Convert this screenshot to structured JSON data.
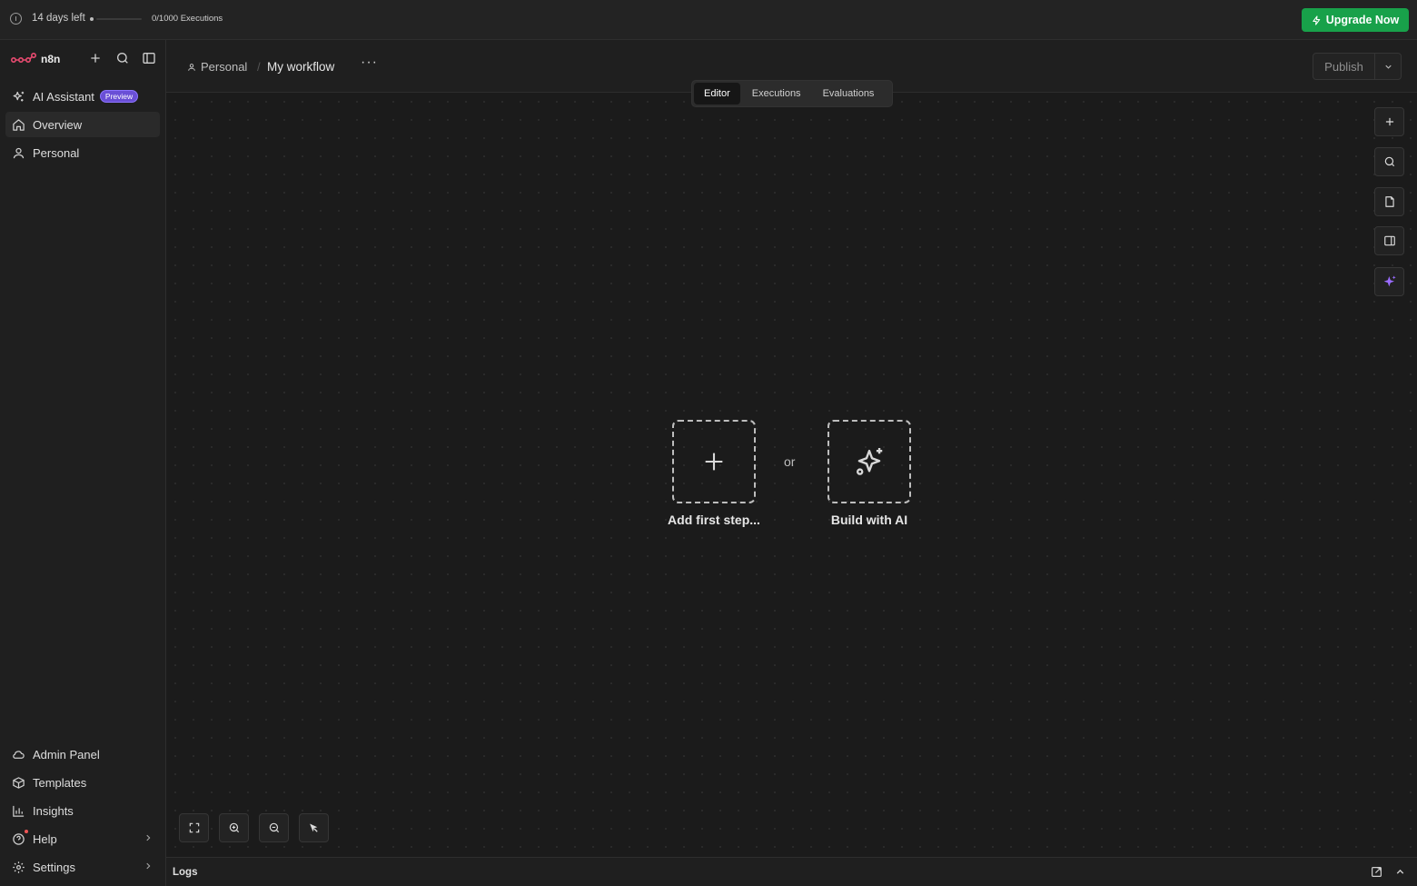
{
  "banner": {
    "trial_text": "14 days left",
    "executions_text": "0/1000 Executions",
    "executions_progress": 0,
    "upgrade_label": "Upgrade Now",
    "upgrade_color": "#18a14a"
  },
  "sidebar": {
    "logo_text": "n8n",
    "items": [
      {
        "label": "AI Assistant",
        "badge": "Preview",
        "icon": "sparkles-icon"
      },
      {
        "label": "Overview",
        "icon": "home-icon",
        "active": true
      },
      {
        "label": "Personal",
        "icon": "user-icon"
      }
    ],
    "bottom_items": [
      {
        "label": "Admin Panel",
        "icon": "cloud-icon"
      },
      {
        "label": "Templates",
        "icon": "box-icon"
      },
      {
        "label": "Insights",
        "icon": "bar-chart-icon"
      },
      {
        "label": "Help",
        "icon": "help-circle-icon"
      },
      {
        "label": "Settings",
        "icon": "gear-icon"
      }
    ]
  },
  "header": {
    "project": "Personal",
    "workflow_name": "My workflow",
    "more_label": "···",
    "publish_label": "Publish"
  },
  "tabs": [
    "Editor",
    "Executions",
    "Evaluations"
  ],
  "active_tab": "Editor",
  "canvas": {
    "add_first_step_label": "Add first step...",
    "or_label": "or",
    "build_ai_label": "Build with AI"
  },
  "logs": {
    "label": "Logs"
  },
  "colors": {
    "background": "#1b1b1b",
    "brand": "#ea4b71",
    "ai_accent": "#9b6cff"
  }
}
